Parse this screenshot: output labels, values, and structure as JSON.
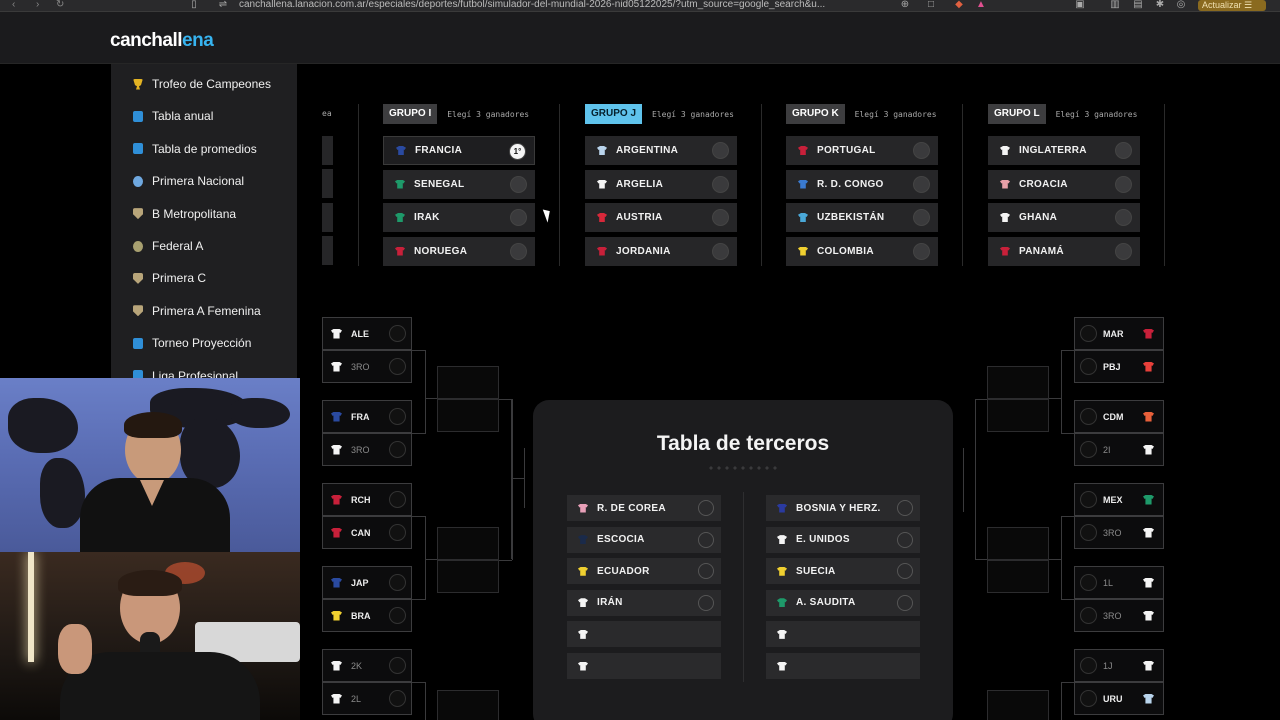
{
  "browser": {
    "url": "canchallena.lanacion.com.ar/especiales/deportes/futbol/simulador-del-mundial-2026-nid05122025/?utm_source=google_search&u...",
    "update_label": "Actualizar"
  },
  "site": {
    "logo_main": "canchall",
    "logo_accent": "ena"
  },
  "sidebar": {
    "items": [
      {
        "label": "Trofeo de Campeones",
        "icon": "trophy-icon"
      },
      {
        "label": "Tabla anual",
        "icon": "phone-icon"
      },
      {
        "label": "Tabla de promedios",
        "icon": "phone-icon"
      },
      {
        "label": "Primera Nacional",
        "icon": "ball-icon"
      },
      {
        "label": "B Metropolitana",
        "icon": "shield-icon"
      },
      {
        "label": "Federal A",
        "icon": "round-icon"
      },
      {
        "label": "Primera C",
        "icon": "shield-icon"
      },
      {
        "label": "Primera A Femenina",
        "icon": "shield-icon"
      },
      {
        "label": "Torneo Proyección",
        "icon": "phone-icon"
      },
      {
        "label": "Liga Profesional",
        "icon": "phone-icon"
      }
    ]
  },
  "groups": [
    {
      "name": "GRUPO I",
      "hint": "Elegí 3 ganadores",
      "active": false,
      "teams": [
        {
          "name": "FRANCIA",
          "color": "#2a4aa0",
          "position": "1°"
        },
        {
          "name": "SENEGAL",
          "color": "#1e9a6a",
          "position": ""
        },
        {
          "name": "IRAK",
          "color": "#1e9a6a",
          "position": ""
        },
        {
          "name": "NORUEGA",
          "color": "#c8203a",
          "position": ""
        }
      ]
    },
    {
      "name": "GRUPO J",
      "hint": "Elegí 3 ganadores",
      "active": true,
      "teams": [
        {
          "name": "ARGENTINA",
          "color": "#b9d4ec",
          "position": ""
        },
        {
          "name": "ARGELIA",
          "color": "#f4f4f4",
          "position": ""
        },
        {
          "name": "AUSTRIA",
          "color": "#d8283a",
          "position": ""
        },
        {
          "name": "JORDANIA",
          "color": "#c8203a",
          "position": ""
        }
      ]
    },
    {
      "name": "GRUPO K",
      "hint": "Elegí 3 ganadores",
      "active": false,
      "teams": [
        {
          "name": "PORTUGAL",
          "color": "#c8203a",
          "position": ""
        },
        {
          "name": "R. D. CONGO",
          "color": "#3a7ad0",
          "position": ""
        },
        {
          "name": "UZBEKISTÁN",
          "color": "#4aa8d8",
          "position": ""
        },
        {
          "name": "COLOMBIA",
          "color": "#f0d030",
          "position": ""
        }
      ]
    },
    {
      "name": "GRUPO L",
      "hint": "Elegí 3 ganadores",
      "active": false,
      "teams": [
        {
          "name": "INGLATERRA",
          "color": "#f4f4f4",
          "position": ""
        },
        {
          "name": "CROACIA",
          "color": "#e8a0a8",
          "position": ""
        },
        {
          "name": "GHANA",
          "color": "#f4f4f4",
          "position": ""
        },
        {
          "name": "PANAMÁ",
          "color": "#c8203a",
          "position": ""
        }
      ]
    }
  ],
  "partial_group_hint": "ea",
  "bracket_left": [
    {
      "label": "ALE",
      "color": "#f4f4f4",
      "dim": false
    },
    {
      "label": "3RO",
      "color": "#f4f4f4",
      "dim": true
    },
    {
      "label": "FRA",
      "color": "#2a4aa0",
      "dim": false
    },
    {
      "label": "3RO",
      "color": "#f4f4f4",
      "dim": true
    },
    {
      "label": "RCH",
      "color": "#c8203a",
      "dim": false
    },
    {
      "label": "CAN",
      "color": "#c8203a",
      "dim": false
    },
    {
      "label": "JAP",
      "color": "#2a4aa0",
      "dim": false
    },
    {
      "label": "BRA",
      "color": "#f0d030",
      "dim": false
    },
    {
      "label": "2K",
      "color": "#f4f4f4",
      "dim": true
    },
    {
      "label": "2L",
      "color": "#f4f4f4",
      "dim": true
    }
  ],
  "bracket_right": [
    {
      "label": "MAR",
      "color": "#c8203a",
      "dim": false
    },
    {
      "label": "PBJ",
      "color": "#e8403a",
      "dim": false
    },
    {
      "label": "CDM",
      "color": "#e8603a",
      "dim": false
    },
    {
      "label": "2I",
      "color": "#f4f4f4",
      "dim": true
    },
    {
      "label": "MEX",
      "color": "#1e9a6a",
      "dim": false
    },
    {
      "label": "3RO",
      "color": "#f4f4f4",
      "dim": true
    },
    {
      "label": "1L",
      "color": "#f4f4f4",
      "dim": true
    },
    {
      "label": "3RO",
      "color": "#f4f4f4",
      "dim": true
    },
    {
      "label": "1J",
      "color": "#f4f4f4",
      "dim": true
    },
    {
      "label": "URU",
      "color": "#b9d4ec",
      "dim": false
    }
  ],
  "terceros": {
    "title": "Tabla de terceros",
    "left": [
      {
        "name": "R. DE COREA",
        "color": "#e8a0b8"
      },
      {
        "name": "ESCOCIA",
        "color": "#1a2a4a"
      },
      {
        "name": "ECUADOR",
        "color": "#f0d030"
      },
      {
        "name": "IRÁN",
        "color": "#f4f4f4"
      },
      {
        "name": "",
        "color": "#f4f4f4"
      },
      {
        "name": "",
        "color": "#f4f4f4"
      }
    ],
    "right": [
      {
        "name": "BOSNIA Y HERZ.",
        "color": "#2a3aa0"
      },
      {
        "name": "E. UNIDOS",
        "color": "#f4f4f4"
      },
      {
        "name": "SUECIA",
        "color": "#f0d030"
      },
      {
        "name": "A. SAUDITA",
        "color": "#1e9a6a"
      },
      {
        "name": "",
        "color": "#f4f4f4"
      },
      {
        "name": "",
        "color": "#f4f4f4"
      }
    ]
  }
}
